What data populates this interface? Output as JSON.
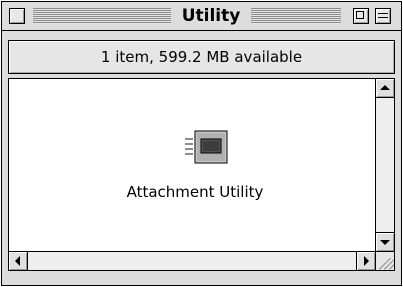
{
  "window": {
    "title": "Utility",
    "info_text": "1 item, 599.2 MB available"
  },
  "items": [
    {
      "label": "Attachment Utility",
      "icon": "application-icon"
    }
  ],
  "icons": {
    "close": "close-box-icon",
    "zoom": "zoom-box-icon",
    "collapse": "collapse-box-icon",
    "scroll_up": "arrow-up-icon",
    "scroll_down": "arrow-down-icon",
    "scroll_left": "arrow-left-icon",
    "scroll_right": "arrow-right-icon",
    "resize": "resize-grip-icon"
  },
  "colors": {
    "chrome": "#dddddd",
    "content_bg": "#ffffff",
    "border": "#000000"
  }
}
